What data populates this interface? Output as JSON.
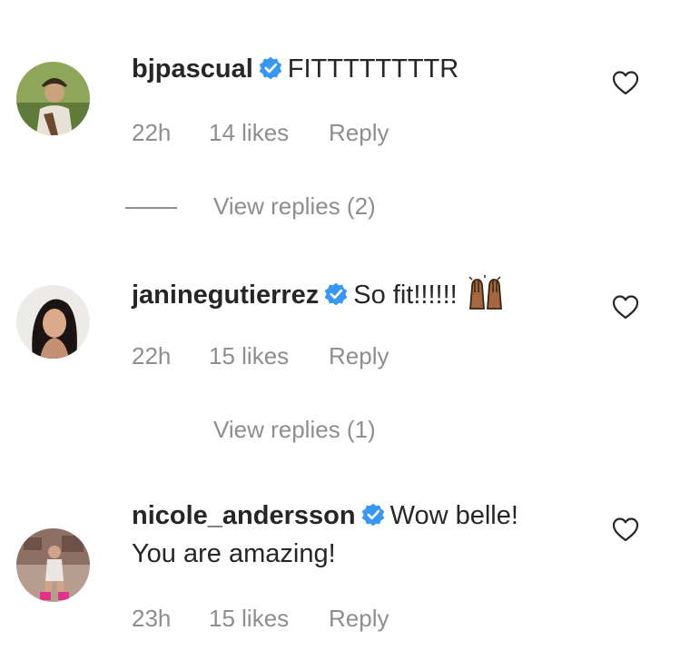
{
  "comments": [
    {
      "username": "bjpascual",
      "text": "FITTTTTTTTR",
      "text_line2": "",
      "time": "22h",
      "likes": "14 likes",
      "reply": "Reply",
      "view_replies": "View replies (2)",
      "has_line": true
    },
    {
      "username": "janinegutierrez",
      "text": "So fit!!!!!!",
      "text_line2": "",
      "time": "22h",
      "likes": "15 likes",
      "reply": "Reply",
      "view_replies": "View replies (1)",
      "has_line": false,
      "emoji": "raising-hands-emoji"
    },
    {
      "username": "nicole_andersson",
      "text": "Wow belle!",
      "text_line2": "You are amazing!",
      "time": "23h",
      "likes": "15 likes",
      "reply": "Reply"
    }
  ],
  "icons": {
    "verified": "verified-badge-icon",
    "like": "heart-outline-icon"
  },
  "colors": {
    "text": "#262626",
    "meta": "#8e8e8e",
    "verified_blue": "#3897f0"
  }
}
